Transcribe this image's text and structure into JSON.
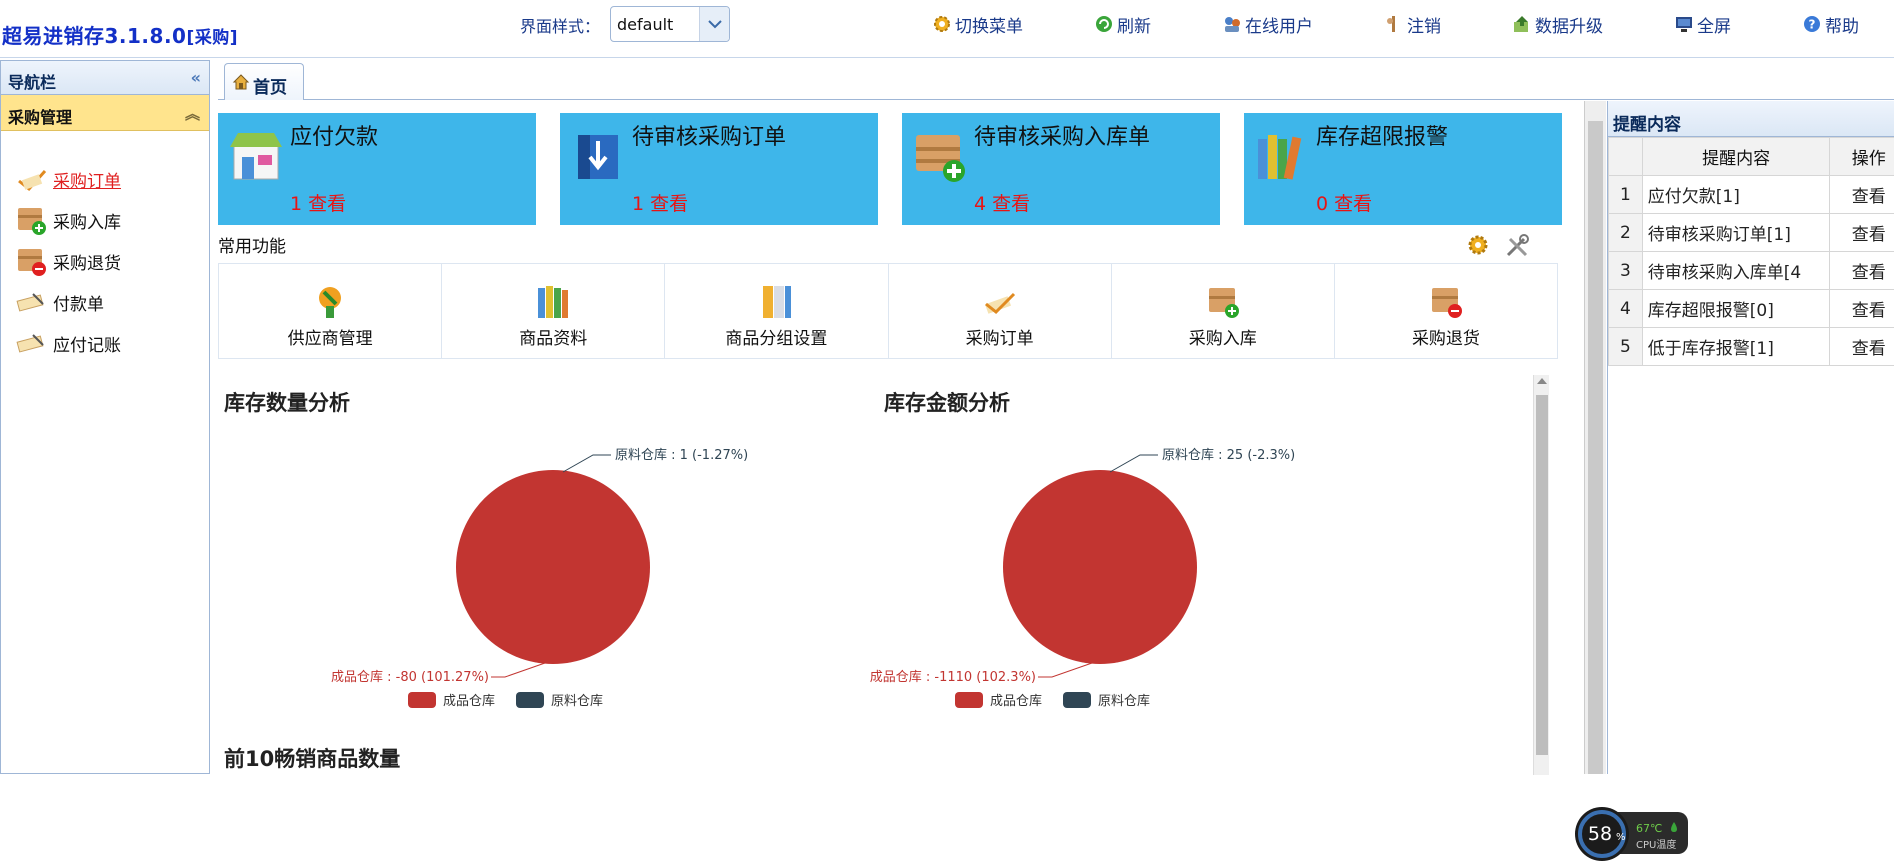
{
  "app": {
    "title": "超易进销存3.1.8.0",
    "title_suffix": "[采购]"
  },
  "topbar": {
    "theme_label": "界面样式：",
    "theme_value": "default",
    "buttons": [
      "切换菜单",
      "刷新",
      "在线用户",
      "注销",
      "数据升级",
      "全屏",
      "帮助"
    ]
  },
  "sidebar": {
    "header": "导航栏",
    "section": "采购管理",
    "items": [
      "采购订单",
      "采购入库",
      "采购退货",
      "付款单",
      "应付记账"
    ]
  },
  "tabs": {
    "home": "首页"
  },
  "kpis": [
    {
      "title": "应付欠款",
      "count": "1 查看"
    },
    {
      "title": "待审核采购订单",
      "count": "1 查看"
    },
    {
      "title": "待审核采购入库单",
      "count": "4 查看"
    },
    {
      "title": "库存超限报警",
      "count": "0 查看"
    }
  ],
  "functions": {
    "title": "常用功能",
    "items": [
      "供应商管理",
      "商品资料",
      "商品分组设置",
      "采购订单",
      "采购入库",
      "采购退货"
    ]
  },
  "chart_data": [
    {
      "type": "pie",
      "title": "库存数量分析",
      "slices": [
        {
          "name": "成品仓库",
          "value": -80,
          "percent": 101.27,
          "label": "成品仓库 : -80 (101.27%)",
          "color": "#c23531"
        },
        {
          "name": "原料仓库",
          "value": 1,
          "percent": -1.27,
          "label": "原料仓库 : 1 (-1.27%)",
          "color": "#2f4554"
        }
      ],
      "legend": [
        "成品仓库",
        "原料仓库"
      ],
      "legend_position": "bottom"
    },
    {
      "type": "pie",
      "title": "库存金额分析",
      "slices": [
        {
          "name": "成品仓库",
          "value": -1110,
          "percent": 102.3,
          "label": "成品仓库 : -1110 (102.3%)",
          "color": "#c23531"
        },
        {
          "name": "原料仓库",
          "value": 25,
          "percent": -2.3,
          "label": "原料仓库 : 25 (-2.3%)",
          "color": "#2f4554"
        }
      ],
      "legend": [
        "成品仓库",
        "原料仓库"
      ],
      "legend_position": "bottom"
    }
  ],
  "top10_title": "前10畅销商品数量",
  "reminder": {
    "header": "提醒内容",
    "columns": [
      "提醒内容",
      "操作"
    ],
    "rows": [
      {
        "num": "1",
        "text": "应付欠款[1]",
        "op": "查看"
      },
      {
        "num": "2",
        "text": "待审核采购订单[1]",
        "op": "查看"
      },
      {
        "num": "3",
        "text": "待审核采购入库单[4",
        "op": "查看"
      },
      {
        "num": "4",
        "text": "库存超限报警[0]",
        "op": "查看"
      },
      {
        "num": "5",
        "text": "低于库存报警[1]",
        "op": "查看"
      }
    ]
  },
  "cpu": {
    "usage": "58",
    "unit": "%",
    "temp": "67℃",
    "temp_label": "CPU温度"
  }
}
